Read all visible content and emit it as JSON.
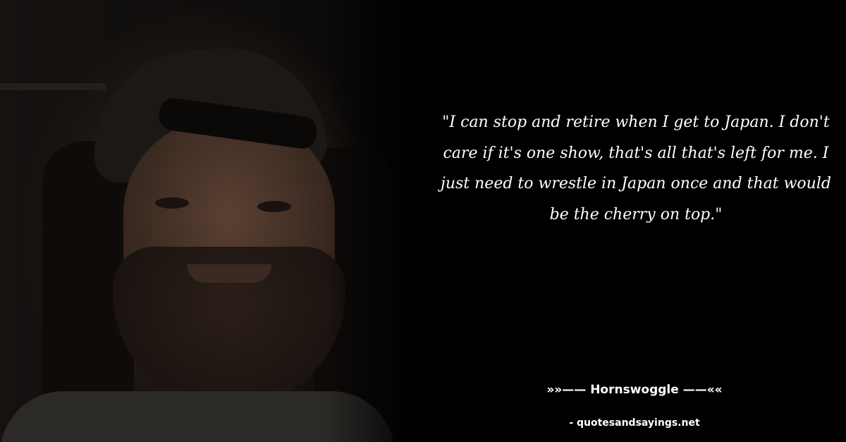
{
  "quote": {
    "text": "\"I can stop and retire when I get to Japan. I don't care if it's one show, that's all that's left for me. I just need to wrestle in Japan once and that would be the cherry on top.\""
  },
  "author": {
    "text": "»»—— Hornswoggle ——««"
  },
  "source": {
    "text": "- quotesandsayings.net"
  },
  "colors": {
    "background": "#000000",
    "text": "#ffffff"
  }
}
